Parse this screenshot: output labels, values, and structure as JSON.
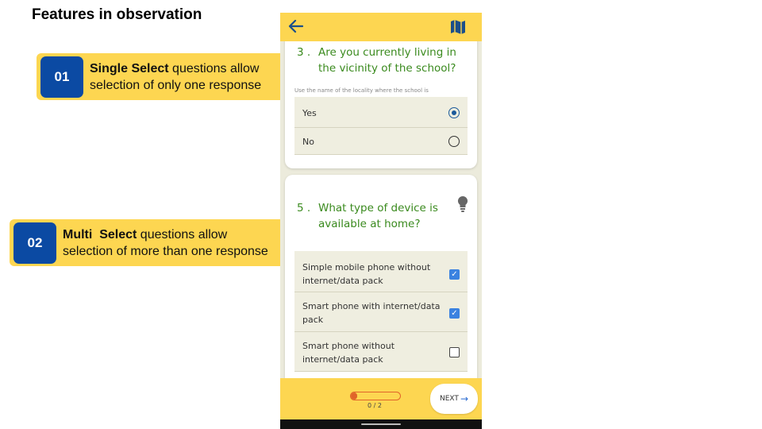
{
  "slide": {
    "title": "Features in observation"
  },
  "callouts": [
    {
      "number": "01",
      "bold": "Single Select",
      "line1_rest": " questions allow",
      "line2": "selection of only one response"
    },
    {
      "number": "02",
      "bold": "Multi  Select",
      "line1_rest": " questions allow",
      "line2": "selection of more than one response"
    }
  ],
  "colors": {
    "accent_yellow": "#fdd651",
    "badge_blue": "#0b4aa3",
    "question_green": "#3a8a1e",
    "progress_orange": "#e0642a",
    "checkbox_blue": "#3b82e0"
  },
  "icons": {
    "back": "arrow-left-icon",
    "map": "map-icon",
    "hint": "lightbulb-icon"
  },
  "q3": {
    "number": "3 .",
    "line1": "Are you currently living in",
    "line2": "the vicinity of the school?",
    "hint": "Use the name of the locality where the school is",
    "options": [
      {
        "label": "Yes",
        "selected": true
      },
      {
        "label": "No",
        "selected": false
      }
    ]
  },
  "q5": {
    "number": "5 .",
    "line1": "What type of device is",
    "line2": "available at home?",
    "options": [
      {
        "line1": "Simple mobile phone without",
        "line2": "internet/data pack",
        "checked": true
      },
      {
        "line1": "Smart phone with internet/data",
        "line2": "pack",
        "checked": true
      },
      {
        "line1": "Smart phone without",
        "line2": "internet/data pack",
        "checked": false
      }
    ]
  },
  "footer": {
    "progress_text": "0 / 2",
    "progress_fraction": 0.13,
    "next_label": "NEXT"
  }
}
